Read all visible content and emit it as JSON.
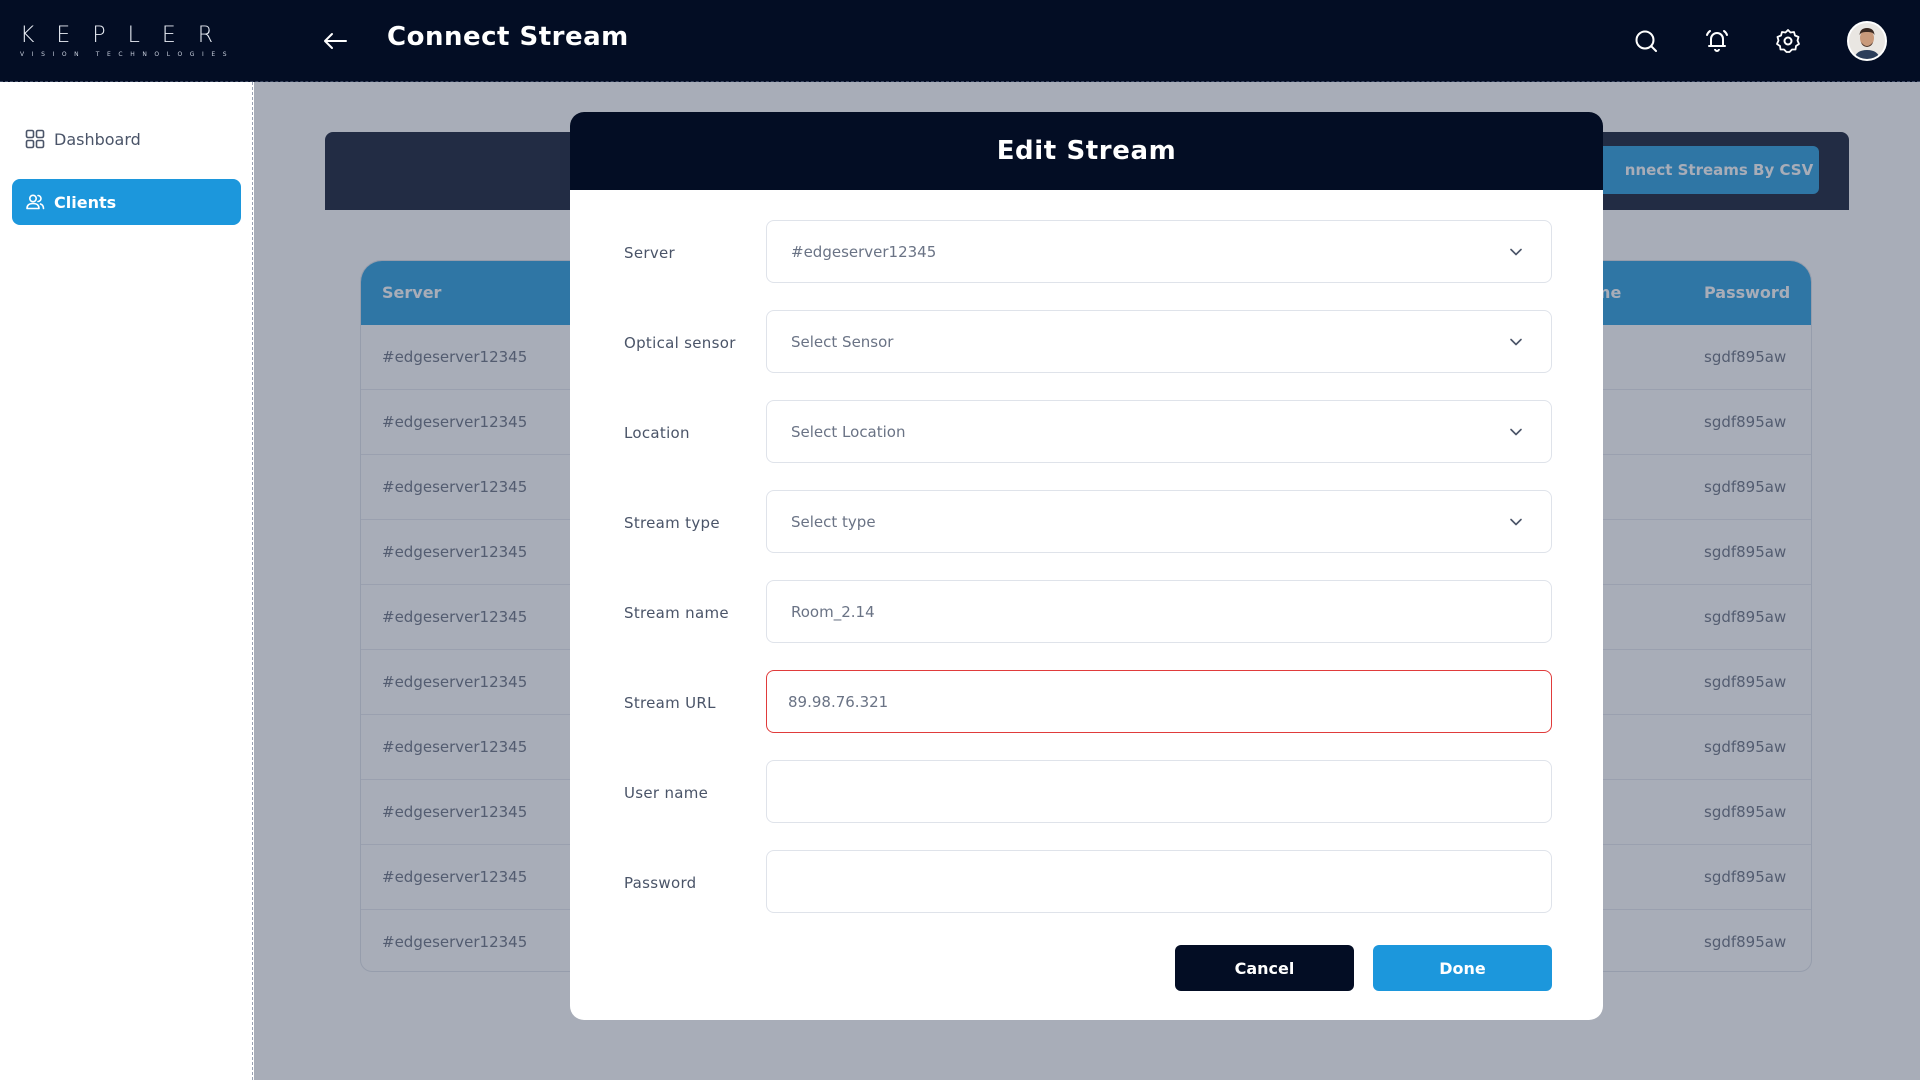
{
  "app": {
    "logo_text": "KEPLER",
    "logo_subtitle": "VISION TECHNOLOGIES",
    "page_title": "Connect Stream"
  },
  "sidebar": {
    "items": [
      {
        "label": "Dashboard",
        "icon": "grid-icon",
        "active": false
      },
      {
        "label": "Clients",
        "icon": "users-icon",
        "active": true
      }
    ]
  },
  "background": {
    "csv_button": "nnect  Streams By CSV",
    "table": {
      "headers": {
        "server": "Server",
        "username": "ame",
        "password": "Password"
      },
      "rows": [
        {
          "server": "#edgeserver12345",
          "password": "sgdf895aw"
        },
        {
          "server": "#edgeserver12345",
          "password": "sgdf895aw"
        },
        {
          "server": "#edgeserver12345",
          "password": "sgdf895aw"
        },
        {
          "server": "#edgeserver12345",
          "password": "sgdf895aw"
        },
        {
          "server": "#edgeserver12345",
          "password": "sgdf895aw"
        },
        {
          "server": "#edgeserver12345",
          "password": "sgdf895aw"
        },
        {
          "server": "#edgeserver12345",
          "password": "sgdf895aw"
        },
        {
          "server": "#edgeserver12345",
          "password": "sgdf895aw"
        },
        {
          "server": "#edgeserver12345",
          "password": "sgdf895aw"
        },
        {
          "server": "#edgeserver12345",
          "password": "sgdf895aw"
        }
      ]
    }
  },
  "modal": {
    "title": "Edit Stream",
    "fields": {
      "server": {
        "label": "Server",
        "value": "#edgeserver12345"
      },
      "optical_sensor": {
        "label": "Optical sensor",
        "placeholder": "Select Sensor"
      },
      "location": {
        "label": "Location",
        "placeholder": "Select Location"
      },
      "stream_type": {
        "label": "Stream type",
        "placeholder": "Select type"
      },
      "stream_name": {
        "label": "Stream name",
        "value": "Room_2.14"
      },
      "stream_url": {
        "label": "Stream URL",
        "value": "89.98.76.321",
        "error": true
      },
      "user_name": {
        "label": "User name",
        "value": ""
      },
      "password": {
        "label": "Password",
        "value": ""
      }
    },
    "buttons": {
      "cancel": "Cancel",
      "done": "Done"
    }
  },
  "colors": {
    "navy": "#030d24",
    "accent": "#1c97dc",
    "error": "#e03b3b"
  }
}
